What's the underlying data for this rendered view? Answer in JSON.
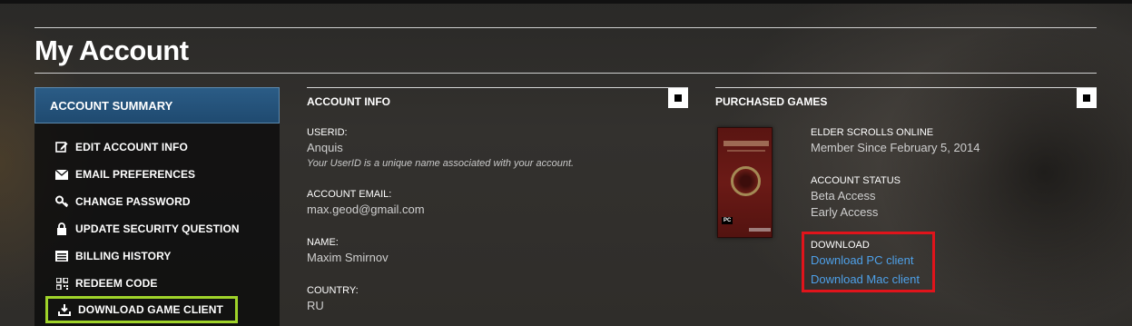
{
  "page": {
    "title": "My Account"
  },
  "sidebar": {
    "header": "ACCOUNT SUMMARY",
    "items": [
      {
        "label": "EDIT ACCOUNT INFO",
        "icon": "edit-icon"
      },
      {
        "label": "EMAIL PREFERENCES",
        "icon": "envelope-icon"
      },
      {
        "label": "CHANGE PASSWORD",
        "icon": "key-icon"
      },
      {
        "label": "UPDATE SECURITY QUESTION",
        "icon": "lock-icon"
      },
      {
        "label": "BILLING HISTORY",
        "icon": "list-icon"
      },
      {
        "label": "REDEEM CODE",
        "icon": "qr-code-icon"
      },
      {
        "label": "DOWNLOAD GAME CLIENT",
        "icon": "download-icon"
      }
    ]
  },
  "account_info": {
    "title": "ACCOUNT INFO",
    "userid_label": "USERID:",
    "userid_value": "Anquis",
    "userid_hint": "Your UserID is a unique name associated with your account.",
    "email_label": "ACCOUNT EMAIL:",
    "email_value": "max.geod@gmail.com",
    "name_label": "NAME:",
    "name_value": "Maxim Smirnov",
    "country_label": "COUNTRY:",
    "country_value": "RU"
  },
  "purchased_games": {
    "title": "PURCHASED GAMES",
    "game_title": "ELDER SCROLLS ONLINE",
    "member_since": "Member Since February 5, 2014",
    "status_label": "ACCOUNT STATUS",
    "status_values": [
      "Beta Access",
      "Early Access"
    ],
    "download_label": "DOWNLOAD",
    "download_pc": "Download PC client",
    "download_mac": "Download Mac client",
    "box_art": {
      "title": "The Elder Scrolls",
      "platform": "PC"
    }
  },
  "colors": {
    "highlight_green": "#9fd32a",
    "highlight_red": "#e0141b",
    "link_blue": "#4ea0e8",
    "header_blue": "#2b5c86"
  }
}
